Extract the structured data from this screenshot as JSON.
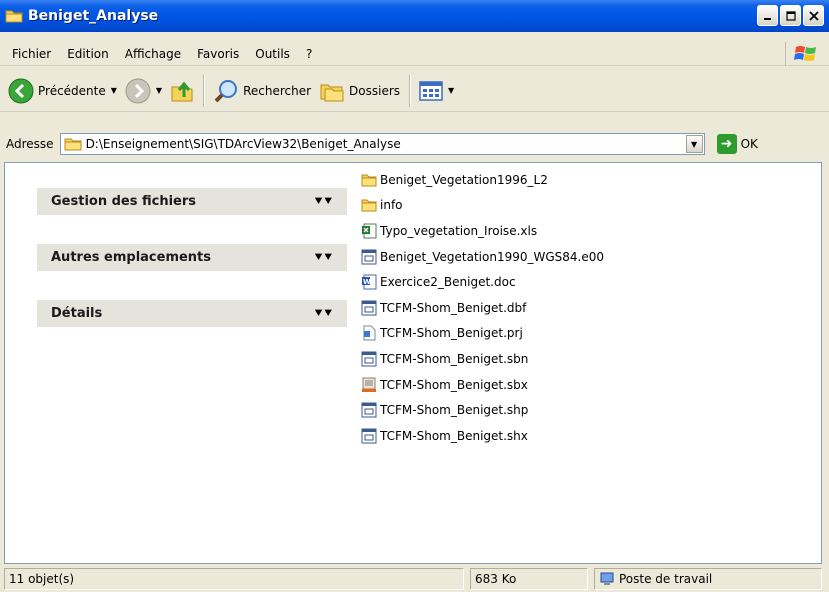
{
  "window": {
    "title": "Beniget_Analyse"
  },
  "menu": [
    "Fichier",
    "Edition",
    "Affichage",
    "Favoris",
    "Outils",
    "?"
  ],
  "toolbar": {
    "back": "Précédente",
    "search": "Rechercher",
    "folders": "Dossiers"
  },
  "address": {
    "label": "Adresse",
    "path": "D:\\Enseignement\\SIG\\TDArcView32\\Beniget_Analyse",
    "go": "OK"
  },
  "tasks": [
    {
      "title": "Gestion des fichiers"
    },
    {
      "title": "Autres emplacements"
    },
    {
      "title": "Détails"
    }
  ],
  "files": [
    {
      "name": "Beniget_Vegetation1996_L2",
      "icon": "folder-icon"
    },
    {
      "name": "info",
      "icon": "folder-icon"
    },
    {
      "name": "Typo_vegetation_Iroise.xls",
      "icon": "excel-icon"
    },
    {
      "name": "Beniget_Vegetation1990_WGS84.e00",
      "icon": "generic-file-icon"
    },
    {
      "name": "Exercice2_Beniget.doc",
      "icon": "word-icon"
    },
    {
      "name": "TCFM-Shom_Beniget.dbf",
      "icon": "generic-file-icon"
    },
    {
      "name": "TCFM-Shom_Beniget.prj",
      "icon": "prj-file-icon"
    },
    {
      "name": "TCFM-Shom_Beniget.sbn",
      "icon": "generic-file-icon"
    },
    {
      "name": "TCFM-Shom_Beniget.sbx",
      "icon": "sbx-file-icon"
    },
    {
      "name": "TCFM-Shom_Beniget.shp",
      "icon": "generic-file-icon"
    },
    {
      "name": "TCFM-Shom_Beniget.shx",
      "icon": "generic-file-icon"
    }
  ],
  "status": {
    "count": "11 objet(s)",
    "size": "683 Ko",
    "location": "Poste de travail"
  }
}
